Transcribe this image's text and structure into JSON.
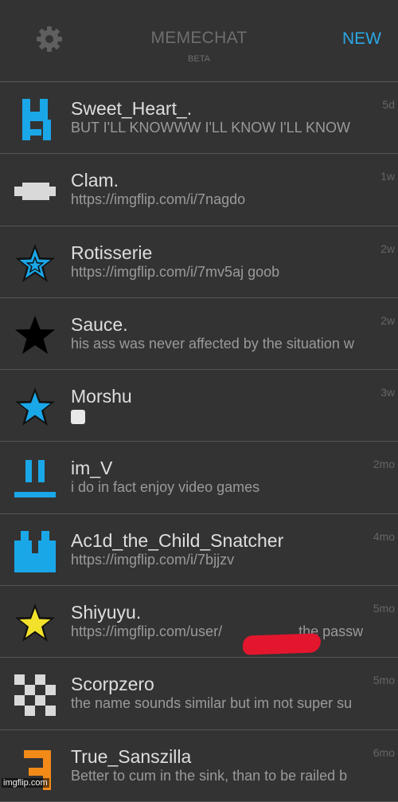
{
  "header": {
    "title": "MEMECHAT",
    "subtitle": "BETA",
    "new_label": "NEW",
    "settings_icon": "gear-icon",
    "accent_color": "#2aa8e6"
  },
  "conversations": [
    {
      "name": "Sweet_Heart_.",
      "message": "BUT I'LL KNOWWW I'LL KNOW I'LL KNOW",
      "time": "5d",
      "avatar": "blue-castle-avatar-icon",
      "avatar_color": "#1aa7e8"
    },
    {
      "name": "Clam.",
      "message": "https://imgflip.com/i/7nagdo",
      "time": "1w",
      "avatar": "gray-block-avatar-icon",
      "avatar_color": "#d9d9d9"
    },
    {
      "name": "Rotisserie",
      "message": "https://imgflip.com/i/7mv5aj goob",
      "time": "2w",
      "avatar": "outline-star-avatar-icon",
      "avatar_color": "#1aa7e8"
    },
    {
      "name": "Sauce.",
      "message": "his ass was never affected by the situation w",
      "time": "2w",
      "avatar": "black-star-avatar-icon",
      "avatar_color": "#000000"
    },
    {
      "name": "Morshu",
      "message": "",
      "time": "3w",
      "avatar": "blue-star-avatar-icon",
      "avatar_color": "#1aa7e8"
    },
    {
      "name": "im_V",
      "message": "i do in fact enjoy video games",
      "time": "2mo",
      "avatar": "blue-face-avatar-icon",
      "avatar_color": "#1aa7e8"
    },
    {
      "name": "Ac1d_the_Child_Snatcher",
      "message": "https://imgflip.com/i/7bjjzv",
      "time": "4mo",
      "avatar": "blue-robot-avatar-icon",
      "avatar_color": "#1aa7e8"
    },
    {
      "name": "Shiyuyu.",
      "message": "https://imgflip.com/user/",
      "message_tail": "the passw",
      "time": "5mo",
      "avatar": "yellow-star-avatar-icon",
      "avatar_color": "#f2e12a"
    },
    {
      "name": "Scorpzero",
      "message": "the name sounds similar but im not super su",
      "time": "5mo",
      "avatar": "checker-avatar-icon",
      "avatar_color": "#d9d9d9"
    },
    {
      "name": "True_Sanszilla",
      "message": "Better to cum in the sink, than to be railed b",
      "time": "6mo",
      "avatar": "orange-pixel-avatar-icon",
      "avatar_color": "#f28a18"
    }
  ],
  "watermark": "imgflip.com"
}
